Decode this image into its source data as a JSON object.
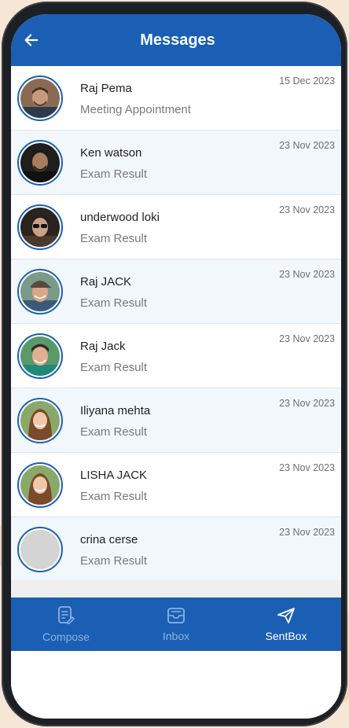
{
  "header": {
    "title": "Messages",
    "back_icon": "arrow-left-icon",
    "color": "#1a5fb4"
  },
  "messages": [
    {
      "name": "Raj Pema",
      "subject": "Meeting Appointment",
      "date": "15 Dec 2023",
      "avatar": "photo-man-beard"
    },
    {
      "name": "Ken watson",
      "subject": "Exam Result",
      "date": "23 Nov 2023",
      "avatar": "photo-man-dark"
    },
    {
      "name": "underwood loki",
      "subject": "Exam Result",
      "date": "23 Nov 2023",
      "avatar": "photo-man-sunglasses"
    },
    {
      "name": "Raj JACK",
      "subject": "Exam Result",
      "date": "23 Nov 2023",
      "avatar": "photo-man-cap"
    },
    {
      "name": "Raj Jack",
      "subject": "Exam Result",
      "date": "23 Nov 2023",
      "avatar": "photo-boy-smile"
    },
    {
      "name": "Iliyana mehta",
      "subject": "Exam Result",
      "date": "23 Nov 2023",
      "avatar": "photo-woman-smile"
    },
    {
      "name": "LISHA JACK",
      "subject": "Exam Result",
      "date": "23 Nov 2023",
      "avatar": "photo-woman-smile"
    },
    {
      "name": "crina cerse",
      "subject": "Exam Result",
      "date": "23 Nov 2023",
      "avatar": "placeholder-grey"
    }
  ],
  "bottom_nav": {
    "items": [
      {
        "label": "Compose",
        "icon": "compose-icon",
        "active": false
      },
      {
        "label": "Inbox",
        "icon": "inbox-icon",
        "active": false
      },
      {
        "label": "SentBox",
        "icon": "send-icon",
        "active": true
      }
    ],
    "active_color": "#ffffff",
    "inactive_color": "#8fb1de"
  }
}
